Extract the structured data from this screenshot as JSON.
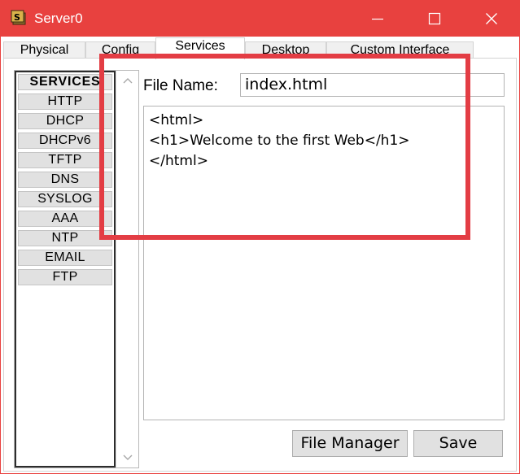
{
  "window": {
    "title": "Server0"
  },
  "tabs": [
    "Physical",
    "Config",
    "Services",
    "Desktop",
    "Custom Interface"
  ],
  "active_tab": "Services",
  "services": {
    "header": "SERVICES",
    "items": [
      "HTTP",
      "DHCP",
      "DHCPv6",
      "TFTP",
      "DNS",
      "SYSLOG",
      "AAA",
      "NTP",
      "EMAIL",
      "FTP"
    ]
  },
  "http_editor": {
    "file_name_label": "File Name:",
    "file_name_value": "index.html",
    "content_lines": [
      "<html>",
      "<h1>Welcome to the first Web</h1>",
      "</html>"
    ],
    "file_manager_label": "File Manager",
    "save_label": "Save"
  },
  "colors": {
    "titlebar": "#e8413f",
    "highlight": "#e33d44"
  },
  "icons": {
    "app": "server-app-icon",
    "minimize": "minimize-icon",
    "maximize": "maximize-icon",
    "close": "close-icon",
    "scroll_up": "chevron-up-icon",
    "scroll_down": "chevron-down-icon"
  }
}
